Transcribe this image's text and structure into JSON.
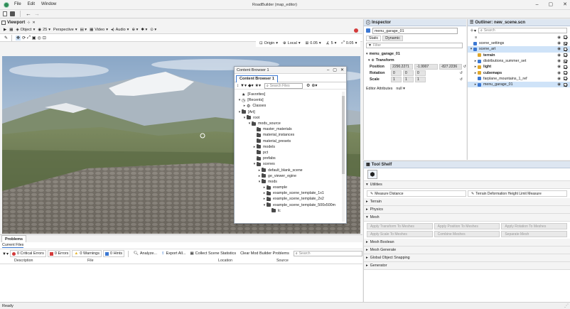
{
  "app": {
    "title": "RoadBuilder (map_editor)",
    "menu": [
      "File",
      "Edit",
      "Window"
    ]
  },
  "viewport": {
    "tab_label": "Viewport",
    "toolbar": {
      "object_label": "Object",
      "fov_value": "25",
      "projection_label": "Perspective",
      "video_label": "Video",
      "audio_label": "Audio"
    },
    "transform_bar": {
      "origin_label": "Origin",
      "local_label": "Local",
      "snap_value_1": "0.05",
      "snap_value_2": "5",
      "snap_value_3": "0.05"
    }
  },
  "content_browser": {
    "window_title": "Content Browser 1",
    "tab_label": "Content Browser 1",
    "search_placeholder": "Search Files",
    "tree": [
      {
        "label": "[Favorites]",
        "indent": 0,
        "kind": "star",
        "arrow": ""
      },
      {
        "label": "[Recents]",
        "indent": 0,
        "kind": "clock",
        "arrow": "▾"
      },
      {
        "label": "Classes",
        "indent": 1,
        "kind": "gear",
        "arrow": "▸"
      },
      {
        "label": "[Art]",
        "indent": 0,
        "kind": "folder",
        "arrow": "▾"
      },
      {
        "label": "root",
        "indent": 1,
        "kind": "folder",
        "arrow": "▾"
      },
      {
        "label": "mods_source",
        "indent": 2,
        "kind": "folder",
        "arrow": "▾"
      },
      {
        "label": "master_materials",
        "indent": 3,
        "kind": "folder",
        "arrow": ""
      },
      {
        "label": "material_instances",
        "indent": 3,
        "kind": "folder",
        "arrow": ""
      },
      {
        "label": "material_presets",
        "indent": 3,
        "kind": "folder",
        "arrow": ""
      },
      {
        "label": "models",
        "indent": 3,
        "kind": "folder",
        "arrow": "▸"
      },
      {
        "label": "pct",
        "indent": 3,
        "kind": "folder",
        "arrow": ""
      },
      {
        "label": "prefabs",
        "indent": 3,
        "kind": "folder",
        "arrow": ""
      },
      {
        "label": "scenes",
        "indent": 3,
        "kind": "folder",
        "arrow": "▾"
      },
      {
        "label": "default_blank_scene",
        "indent": 4,
        "kind": "folder",
        "arrow": "▸"
      },
      {
        "label": "ge_viewer_egine",
        "indent": 4,
        "kind": "folder",
        "arrow": "▸"
      },
      {
        "label": "mods",
        "indent": 4,
        "kind": "folder",
        "arrow": "▾"
      },
      {
        "label": "example",
        "indent": 5,
        "kind": "folder",
        "arrow": "▸"
      },
      {
        "label": "example_scene_template_1x1",
        "indent": 5,
        "kind": "folder",
        "arrow": "▸"
      },
      {
        "label": "example_scene_template_2x2",
        "indent": 5,
        "kind": "folder",
        "arrow": "▸"
      },
      {
        "label": "example_scene_template_500x500m",
        "indent": 5,
        "kind": "folder",
        "arrow": "▾"
      },
      {
        "label": "lc",
        "indent": 6,
        "kind": "folder",
        "arrow": ""
      }
    ]
  },
  "inspector": {
    "title": "Inspector",
    "name_value": "menu_garage_01",
    "static_label": "Static",
    "dynamic_label": "Dynamic",
    "filter_placeholder": "Filter",
    "entity_label": "menu_garage_01",
    "transform_label": "Transform",
    "position_label": "Position",
    "position": [
      "2290.2271",
      "-1.9907",
      "-827.2236"
    ],
    "rotation_label": "Rotation",
    "rotation": [
      "0",
      "0",
      "0"
    ],
    "scale_label": "Scale",
    "scale": [
      "1",
      "1",
      "1"
    ],
    "editor_attributes_label": "Editor Attributes",
    "editor_attributes_value": "null"
  },
  "outliner": {
    "title": "Outliner: new_scene.scn",
    "search_placeholder": "Search",
    "sort_icon_label": "≡",
    "items": [
      {
        "label": "scene_settings",
        "indent": 0,
        "arrow": "",
        "selected": false,
        "bold": false
      },
      {
        "label": "scene_art",
        "indent": 0,
        "arrow": "▾",
        "selected": true,
        "bold": false
      },
      {
        "label": "terrain",
        "indent": 1,
        "arrow": "",
        "selected": false,
        "bold": true
      },
      {
        "label": "distributions_summer_set",
        "indent": 1,
        "arrow": "▸",
        "selected": false,
        "bold": false
      },
      {
        "label": "light",
        "indent": 1,
        "arrow": "▸",
        "selected": false,
        "bold": true
      },
      {
        "label": "cubemaps",
        "indent": 1,
        "arrow": "▸",
        "selected": false,
        "bold": true
      },
      {
        "label": "farplane_mountains_1_ref",
        "indent": 1,
        "arrow": "",
        "selected": false,
        "bold": false
      },
      {
        "label": "menu_garage_01",
        "indent": 1,
        "arrow": "▸",
        "selected": true,
        "bold": false
      }
    ]
  },
  "tool_shelf": {
    "title": "Tool Shelf",
    "sections": [
      {
        "label": "Utilities",
        "expanded": true
      },
      {
        "label": "Terrain",
        "expanded": false
      },
      {
        "label": "Physics",
        "expanded": false
      },
      {
        "label": "Mesh",
        "expanded": true
      },
      {
        "label": "Mesh Boolean",
        "expanded": false
      },
      {
        "label": "Mesh Generate",
        "expanded": false
      },
      {
        "label": "Global Object Snapping",
        "expanded": false
      },
      {
        "label": "Generator",
        "expanded": false
      }
    ],
    "utilities_buttons": [
      "Measure Distance",
      "Terrain Deformation Height Limit Measure"
    ],
    "mesh_buttons": [
      "Apply Transform To Meshes",
      "Apply Position To Meshes",
      "Apply Rotation To Meshes",
      "Apply Scale To Meshes",
      "Combine Meshes",
      "Separate Mesh"
    ]
  },
  "problems": {
    "title": "Problems",
    "tab_label": "Current Files",
    "critical_label": "0 Critical Errors",
    "errors_label": "0 Errors",
    "warnings_label": "0 Warnings",
    "hints_label": "0 Hints",
    "analyze_label": "Analyze...",
    "export_label": "Export All...",
    "collect_label": "Collect Scene Statistics",
    "clear_label": "Clear Mod Builder Problems",
    "search_placeholder": "Search",
    "columns": [
      "Description",
      "File",
      "Location",
      "Source"
    ]
  },
  "status": {
    "text": "Ready"
  },
  "colors": {
    "accent": "#1f6fc7",
    "selection": "#cfe3f8",
    "panel_header": "#dde6f1",
    "error_red": "#d33b3b",
    "warning_yellow": "#e5b631",
    "hint_blue": "#3b78d3"
  }
}
